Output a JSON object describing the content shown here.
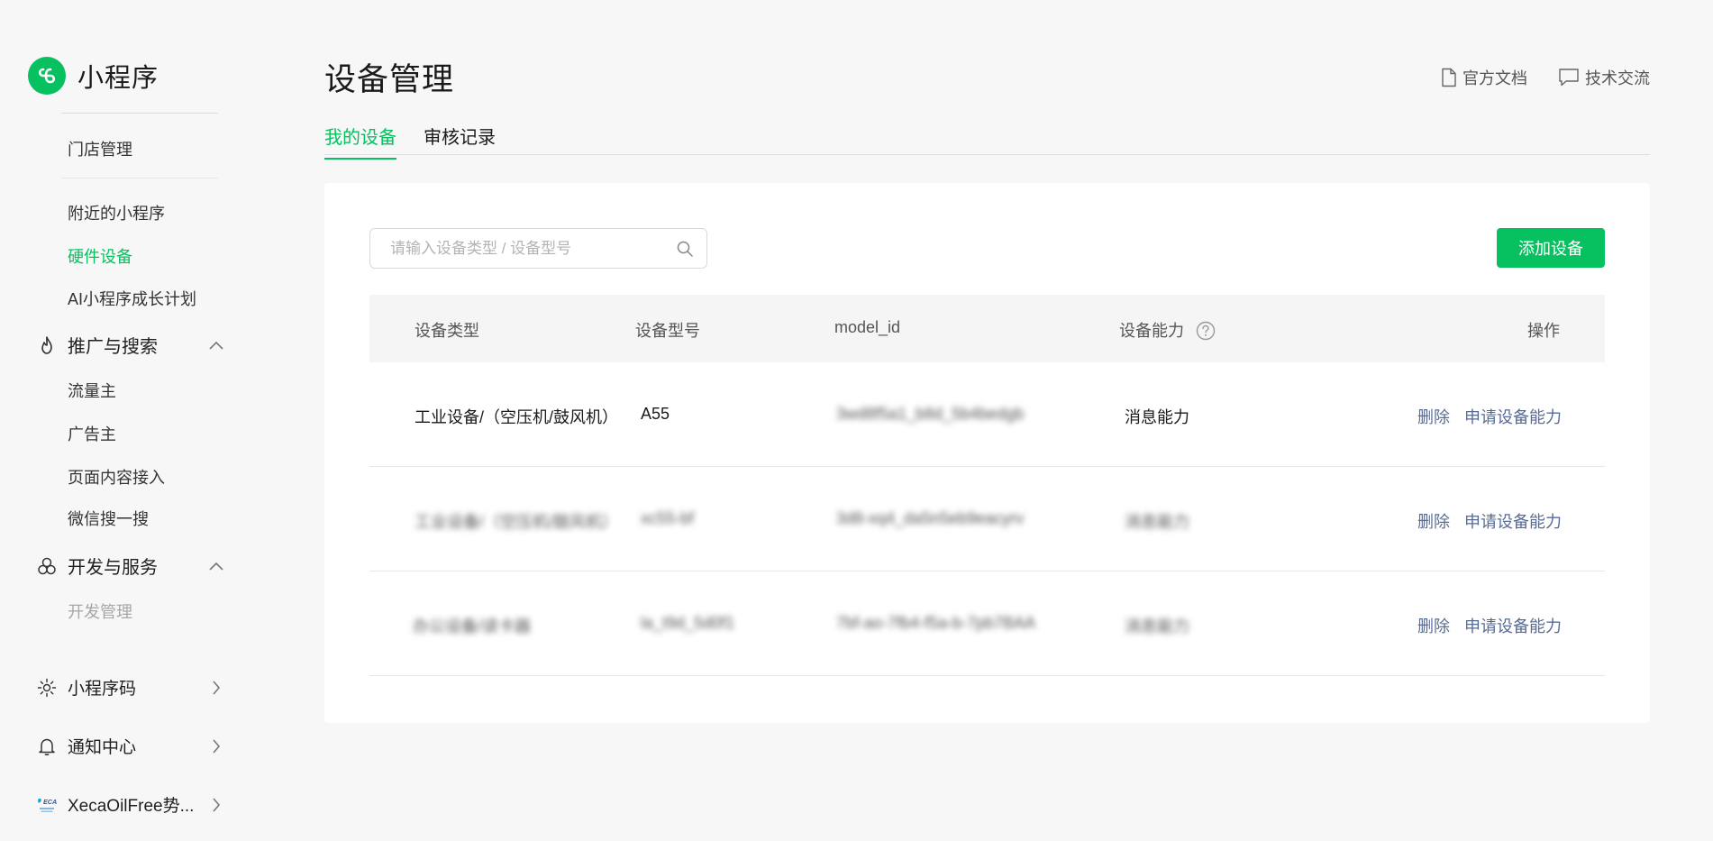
{
  "app": {
    "name": "小程序",
    "accent": "#07c160",
    "link_color": "#576b95"
  },
  "sidebar": {
    "top_item": "门店管理",
    "sub_items": [
      {
        "label": "附近的小程序",
        "state": "normal"
      },
      {
        "label": "硬件设备",
        "state": "active"
      },
      {
        "label": "AI小程序成长计划",
        "state": "normal"
      }
    ],
    "groups": [
      {
        "label": "推广与搜索",
        "icon": "flame-icon",
        "expanded": true,
        "items": [
          "流量主",
          "广告主",
          "页面内容接入",
          "微信搜一搜"
        ]
      },
      {
        "label": "开发与服务",
        "icon": "circles-icon",
        "expanded": true,
        "items": [
          "开发管理"
        ]
      }
    ],
    "bottom": [
      {
        "label": "小程序码",
        "icon": "qrcode-sun-icon"
      },
      {
        "label": "通知中心",
        "icon": "bell-icon"
      },
      {
        "label": "XecaOilFree势...",
        "icon": "account-logo-icon"
      }
    ]
  },
  "header": {
    "title": "设备管理",
    "links": [
      {
        "label": "官方文档",
        "icon": "document-icon"
      },
      {
        "label": "技术交流",
        "icon": "chat-icon"
      }
    ],
    "tabs": [
      {
        "label": "我的设备",
        "active": true
      },
      {
        "label": "审核记录",
        "active": false
      }
    ]
  },
  "toolbar": {
    "search_placeholder": "请输入设备类型 / 设备型号",
    "add_label": "添加设备"
  },
  "table": {
    "columns": [
      "设备类型",
      "设备型号",
      "model_id",
      "设备能力",
      "操作"
    ],
    "rows": [
      {
        "type": "工业设备/（空压机/鼓风机）",
        "model": "A55",
        "model_id": "3wd8f5a1_b8d_5b4bedgb",
        "ability": "消息能力",
        "actions": [
          "删除",
          "申请设备能力"
        ]
      },
      {
        "type": "工业设备/（空压机/鼓风机）",
        "model": "xc55-bf",
        "model_id": "3d8-xq4_da5n5eb9eacyrv",
        "ability": "消息能力",
        "actions": [
          "删除",
          "申请设备能力"
        ]
      },
      {
        "type": "办公设备/读卡器",
        "model": "la_t9d_5d0f1",
        "model_id": "7bf-ao-7fb4-f5a-b-7pb7BAA",
        "ability": "消息能力",
        "actions": [
          "删除",
          "申请设备能力"
        ]
      }
    ]
  }
}
